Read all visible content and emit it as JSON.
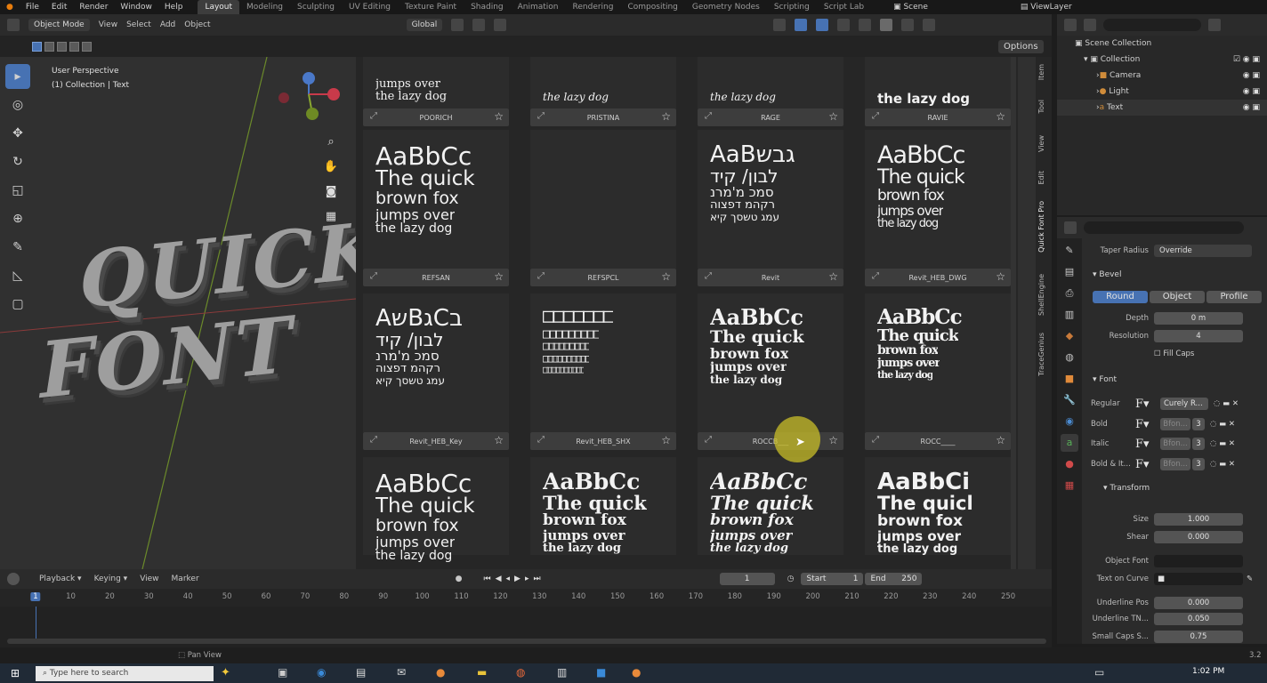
{
  "menu": [
    "File",
    "Edit",
    "Render",
    "Window",
    "Help"
  ],
  "workspaces": [
    "Layout",
    "Modeling",
    "Sculpting",
    "UV Editing",
    "Texture Paint",
    "Shading",
    "Animation",
    "Rendering",
    "Compositing",
    "Geometry Nodes",
    "Scripting",
    "Script Lab"
  ],
  "active_workspace": "Layout",
  "scene": "Scene",
  "view_layer": "ViewLayer",
  "viewport_header": {
    "mode": "Object Mode",
    "view": "View",
    "select": "Select",
    "add": "Add",
    "object": "Object",
    "transform": "Global",
    "options": "Options"
  },
  "viewport": {
    "perspective": "User Perspective",
    "collection": "(1) Collection | Text",
    "text_line1": "QUICK",
    "text_line2": "FONT"
  },
  "font_cards": [
    {
      "label": "POORICH",
      "sample": [
        "jumps over",
        "the lazy dog"
      ],
      "style": "serif-light"
    },
    {
      "label": "PRISTINA",
      "sample": [
        "the lazy dog"
      ],
      "style": "script"
    },
    {
      "label": "RAGE",
      "sample": [
        "the lazy dog"
      ],
      "style": "script"
    },
    {
      "label": "RAVIE",
      "sample": [
        "the lazy dog"
      ],
      "style": "heavy"
    },
    {
      "label": "REFSAN",
      "sample": [
        "AaBbCc",
        "The quick",
        "brown fox",
        "jumps over",
        "the lazy dog"
      ],
      "style": "sans"
    },
    {
      "label": "REFSPCL",
      "sample": [],
      "style": "empty"
    },
    {
      "label": "Revit",
      "sample": [
        "AaBגבש",
        "לבון/ קיד",
        "סמכ מ'מרנ",
        "רקהמ דפצוה",
        "עמג טשסך קיא"
      ],
      "style": "hebrew"
    },
    {
      "label": "Revit_HEB_DWG",
      "sample": [
        "AaBbCc",
        "The quick",
        "brown fox",
        "jumps over",
        "the lazy dog"
      ],
      "style": "sans-narrow"
    },
    {
      "label": "Revit_HEB_Key",
      "sample": [
        "AשBגCב",
        "לבון/ קיד",
        "סמכ מ'מרנ",
        "רקהמ דפצוה",
        "עמג טשסך קיא"
      ],
      "style": "hebrew"
    },
    {
      "label": "Revit_HEB_SHX",
      "sample": [
        "□□□□□□□",
        "□□□□□□□□□",
        "□□□□□□□□□",
        "□□□□□□□□□□",
        "□□□□□□□□□□"
      ],
      "style": "boxes"
    },
    {
      "label": "ROCCB___",
      "sample": [
        "AaBbCc",
        "The quick",
        "brown fox",
        "jumps over",
        "the lazy dog"
      ],
      "style": "slab"
    },
    {
      "label": "ROCC____",
      "sample": [
        "AaBbCc",
        "The quick",
        "brown fox",
        "jumps over",
        "the lazy dog"
      ],
      "style": "slab-cond"
    },
    {
      "label": "",
      "sample": [
        "AaBbCc",
        "The quick",
        "brown fox",
        "jumps over",
        "the lazy dog"
      ],
      "style": "sans"
    },
    {
      "label": "",
      "sample": [
        "AaBbCc",
        "The quick",
        "brown fox",
        "jumps over",
        "the lazy dog"
      ],
      "style": "slab-bold"
    },
    {
      "label": "",
      "sample": [
        "AaBbCc",
        "The quick",
        "brown fox",
        "jumps over",
        "the lazy dog"
      ],
      "style": "slab-italic"
    },
    {
      "label": "",
      "sample": [
        "AaBbCi",
        "The quicl",
        "brown fox",
        "jumps over",
        "the lazy dog"
      ],
      "style": "heavy-sans"
    }
  ],
  "side_tabs": [
    "Item",
    "Tool",
    "View",
    "Edit",
    "Quick Font Pro",
    "ShellEngine",
    "TraceGenius"
  ],
  "outliner": {
    "root": "Scene Collection",
    "items": [
      {
        "name": "Collection",
        "level": 1
      },
      {
        "name": "Camera",
        "level": 2
      },
      {
        "name": "Light",
        "level": 2
      },
      {
        "name": "Text",
        "level": 2
      }
    ]
  },
  "properties": {
    "taper_radius_label": "Taper Radius",
    "taper_radius": "Override",
    "bevel_header": "Bevel",
    "bevel_modes": [
      "Round",
      "Object",
      "Profile"
    ],
    "depth_label": "Depth",
    "depth": "0 m",
    "resolution_label": "Resolution",
    "resolution": "4",
    "fill_caps": "Fill Caps",
    "font_header": "Font",
    "regular_label": "Regular",
    "regular_font": "Curely R...",
    "bold_label": "Bold",
    "italic_label": "Italic",
    "bold_italic_label": "Bold & It...",
    "bfont": "Bfon...",
    "user_count": "3",
    "transform_header": "Transform",
    "size_label": "Size",
    "size": "1.000",
    "shear_label": "Shear",
    "shear": "0.000",
    "object_font_label": "Object Font",
    "text_on_curve_label": "Text on Curve",
    "underline_pos_label": "Underline Pos",
    "underline_pos": "0.000",
    "underline_thk_label": "Underline TN...",
    "underline_thk": "0.050",
    "small_caps_label": "Small Caps S...",
    "small_caps": "0.75"
  },
  "timeline": {
    "playback": "Playback",
    "keying": "Keying",
    "view": "View",
    "marker": "Marker",
    "current_frame": "1",
    "start_label": "Start",
    "start": "1",
    "end_label": "End",
    "end": "250",
    "ticks": [
      "1",
      "10",
      "20",
      "30",
      "40",
      "50",
      "60",
      "70",
      "80",
      "90",
      "100",
      "110",
      "120",
      "130",
      "140",
      "150",
      "160",
      "170",
      "180",
      "190",
      "200",
      "210",
      "220",
      "230",
      "240",
      "250"
    ]
  },
  "status": {
    "pan_view": "Pan View",
    "version": "3.2"
  },
  "taskbar": {
    "search": "Type here to search",
    "time": "1:02 PM"
  },
  "colors": {
    "accent": "#4772b3",
    "bg": "#303030",
    "panel": "#2b2b2b"
  }
}
